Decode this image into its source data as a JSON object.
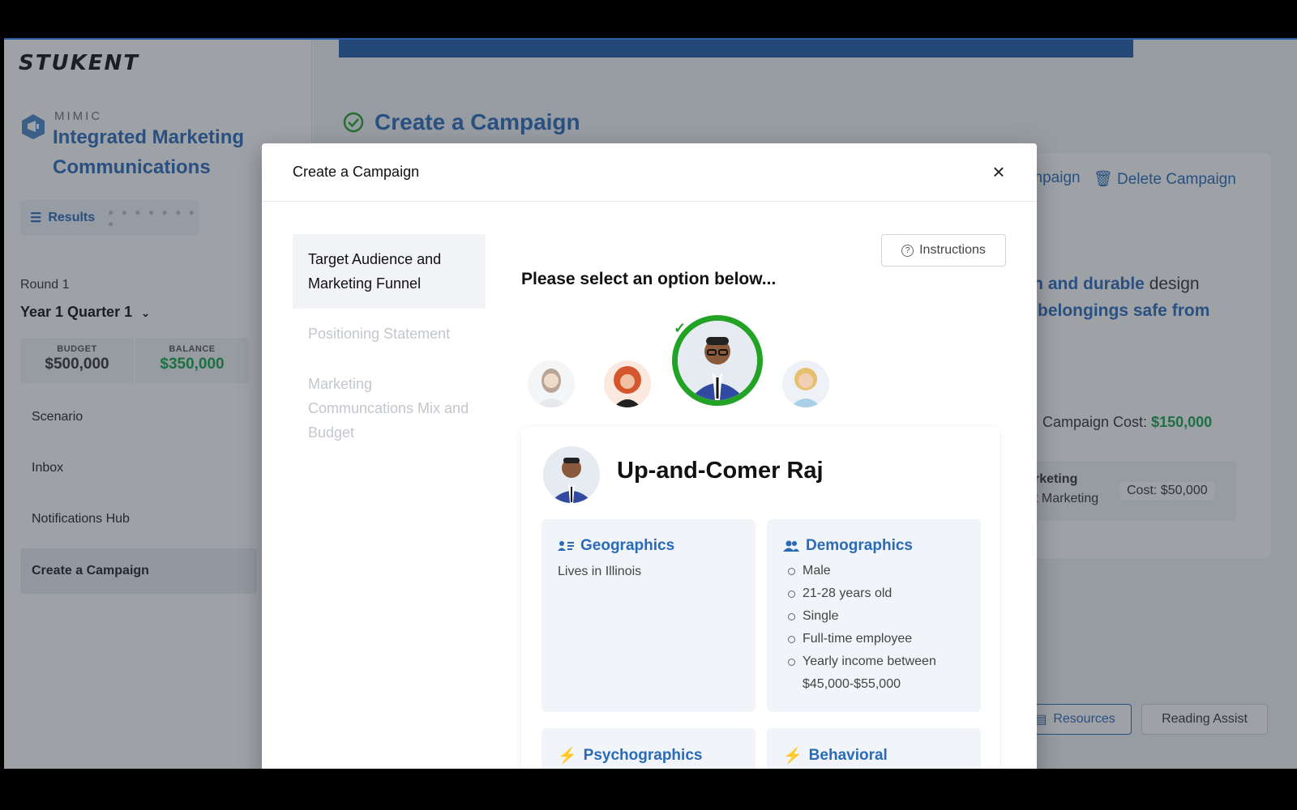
{
  "sidebar": {
    "logo": "STUKENT",
    "product_label": "MIMIC",
    "course_title": "Integrated Marketing Communications",
    "results_label": "Results",
    "round_label": "Round 1",
    "quarter_label": "Year 1 Quarter 1",
    "budget_label": "BUDGET",
    "budget_value": "$500,000",
    "balance_label": "BALANCE",
    "balance_value": "$350,000",
    "nav": [
      "Scenario",
      "Inbox",
      "Notifications Hub",
      "Create a Campaign"
    ]
  },
  "main": {
    "title": "Create a Campaign",
    "edit_campaign": "Campaign",
    "delete_campaign": "Delete Campaign",
    "design_pre": "rn and durable",
    "design_mid": " design",
    "design_line2": "r belongings safe from",
    "campaign_cost_label": "Campaign Cost: ",
    "campaign_cost_value": "$150,000",
    "mk_title": "rketing",
    "mk_sub": "t Marketing",
    "mk_cost": "Cost: $50,000",
    "resources_label": "Resources",
    "reading_assist_label": "Reading Assist"
  },
  "modal": {
    "title": "Create a Campaign",
    "steps": [
      "Target Audience and Marketing Funnel",
      "Positioning Statement",
      "Marketing Communcations Mix and Budget"
    ],
    "instructions_label": "Instructions",
    "prompt": "Please select an option below...",
    "persona": {
      "name": "Up-and-Comer Raj",
      "geographics_title": "Geographics",
      "geographics_text": "Lives in Illinois",
      "demographics_title": "Demographics",
      "demographics": [
        "Male",
        "21-28 years old",
        "Single",
        "Full-time employee",
        "Yearly income between $45,000-$55,000"
      ],
      "psychographics_title": "Psychographics",
      "behavioral_title": "Behavioral"
    }
  },
  "colors": {
    "brand_blue": "#2a6bb8",
    "success_green": "#22a325",
    "money_green": "#16a34a"
  }
}
